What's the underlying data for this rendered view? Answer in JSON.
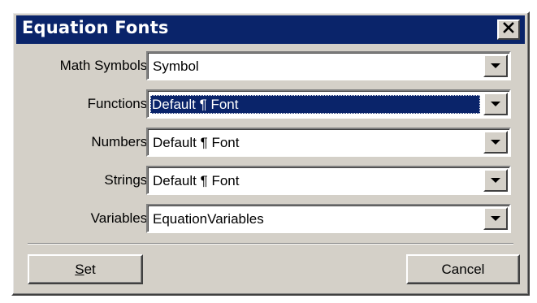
{
  "window": {
    "title": "Equation Fonts",
    "close_icon": "close-icon"
  },
  "rows": [
    {
      "label": "Math Symbols:",
      "value": "Symbol"
    },
    {
      "label": "Functions:",
      "value": "Default ¶ Font"
    },
    {
      "label": "Numbers:",
      "value": "Default ¶ Font"
    },
    {
      "label": "Strings:",
      "value": "Default ¶ Font"
    },
    {
      "label": "Variables:",
      "value": "EquationVariables"
    }
  ],
  "buttons": {
    "set_access_key": "S",
    "set_rest": "et",
    "cancel": "Cancel"
  },
  "colors": {
    "titlebar": "#0a246a",
    "dialog_face": "#d4d0c8",
    "selection": "#0a246a"
  }
}
